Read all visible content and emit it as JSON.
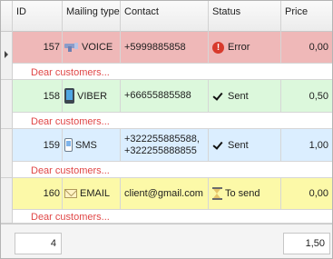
{
  "columns": {
    "id": "ID",
    "type": "Mailing type",
    "contact": "Contact",
    "status": "Status",
    "price": "Price"
  },
  "rows": [
    {
      "id": "157",
      "type": "VOICE",
      "type_icon": "voice-icon",
      "contact": "+5999885858",
      "contact2": "",
      "status": "Error",
      "status_icon": "error-icon",
      "price": "0,00",
      "preview": "Dear customers...",
      "bg": "#efb8b8"
    },
    {
      "id": "158",
      "type": "VIBER",
      "type_icon": "phone-icon",
      "contact": "+66655885588",
      "contact2": "",
      "status": "Sent",
      "status_icon": "check-icon",
      "price": "0,50",
      "preview": "Dear customers...",
      "bg": "#dcf8dc"
    },
    {
      "id": "159",
      "type": "SMS",
      "type_icon": "mobile-phone-icon",
      "contact": "+322255885588,",
      "contact2": "+322255888855",
      "status": "Sent",
      "status_icon": "check-icon",
      "price": "1,00",
      "preview": "Dear customers...",
      "bg": "#dbeeff"
    },
    {
      "id": "160",
      "type": "EMAIL",
      "type_icon": "envelope-icon",
      "contact": "client@gmail.com",
      "contact2": "",
      "status": "To send",
      "status_icon": "hourglass-icon",
      "price": "0,00",
      "preview": "Dear customers...",
      "bg": "#fcf9a8"
    }
  ],
  "footer": {
    "count": "4",
    "total": "1,50"
  },
  "colors": {
    "error_row": "#efb8b8",
    "sent_viber_row": "#dcf8dc",
    "sent_sms_row": "#dbeeff",
    "pending_row": "#fcf9a8",
    "preview_text": "#e04747"
  }
}
